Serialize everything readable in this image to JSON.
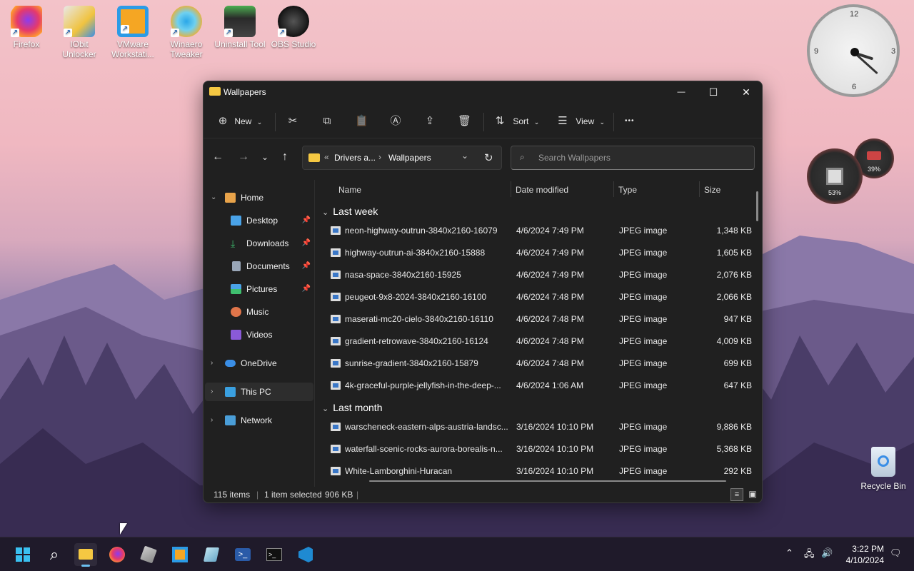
{
  "desktop": {
    "icons": [
      {
        "label": "Firefox"
      },
      {
        "label": "IObit Unlocker"
      },
      {
        "label": "VMware Workstati..."
      },
      {
        "label": "Winaero Tweaker"
      },
      {
        "label": "Uninstall Tool"
      },
      {
        "label": "OBS Studio"
      }
    ],
    "recycle_bin": "Recycle Bin",
    "clock_numbers": {
      "n12": "12",
      "n3": "3",
      "n6": "6",
      "n9": "9"
    },
    "gauges": {
      "cpu": "53%",
      "ram": "39%"
    }
  },
  "window": {
    "title": "Wallpapers",
    "controls": {
      "minimize": "—",
      "maximize": "☐",
      "close": "✕"
    },
    "toolbar": {
      "new_label": "New",
      "sort_label": "Sort",
      "view_label": "View",
      "more_label": "•••"
    },
    "address": {
      "overflow": "«",
      "crumb1": "Drivers a...",
      "crumb_sep": "›",
      "crumb2": "Wallpapers"
    },
    "search": {
      "placeholder": "Search Wallpapers"
    },
    "sidebar": {
      "items": [
        {
          "label": "Home"
        },
        {
          "label": "Desktop"
        },
        {
          "label": "Downloads"
        },
        {
          "label": "Documents"
        },
        {
          "label": "Pictures"
        },
        {
          "label": "Music"
        },
        {
          "label": "Videos"
        },
        {
          "label": "OneDrive"
        },
        {
          "label": "This PC"
        },
        {
          "label": "Network"
        }
      ]
    },
    "columns": {
      "name": "Name",
      "date": "Date modified",
      "type": "Type",
      "size": "Size"
    },
    "groups": [
      {
        "label": "Last week",
        "files": [
          {
            "name": "neon-highway-outrun-3840x2160-16079",
            "date": "4/6/2024 7:49 PM",
            "type": "JPEG image",
            "size": "1,348 KB"
          },
          {
            "name": "highway-outrun-ai-3840x2160-15888",
            "date": "4/6/2024 7:49 PM",
            "type": "JPEG image",
            "size": "1,605 KB"
          },
          {
            "name": "nasa-space-3840x2160-15925",
            "date": "4/6/2024 7:49 PM",
            "type": "JPEG image",
            "size": "2,076 KB"
          },
          {
            "name": "peugeot-9x8-2024-3840x2160-16100",
            "date": "4/6/2024 7:48 PM",
            "type": "JPEG image",
            "size": "2,066 KB"
          },
          {
            "name": "maserati-mc20-cielo-3840x2160-16110",
            "date": "4/6/2024 7:48 PM",
            "type": "JPEG image",
            "size": "947 KB"
          },
          {
            "name": "gradient-retrowave-3840x2160-16124",
            "date": "4/6/2024 7:48 PM",
            "type": "JPEG image",
            "size": "4,009 KB"
          },
          {
            "name": "sunrise-gradient-3840x2160-15879",
            "date": "4/6/2024 7:48 PM",
            "type": "JPEG image",
            "size": "699 KB"
          },
          {
            "name": "4k-graceful-purple-jellyfish-in-the-deep-...",
            "date": "4/6/2024 1:06 AM",
            "type": "JPEG image",
            "size": "647 KB"
          }
        ]
      },
      {
        "label": "Last month",
        "files": [
          {
            "name": "warscheneck-eastern-alps-austria-landsc...",
            "date": "3/16/2024 10:10 PM",
            "type": "JPEG image",
            "size": "9,886 KB"
          },
          {
            "name": "waterfall-scenic-rocks-aurora-borealis-n...",
            "date": "3/16/2024 10:10 PM",
            "type": "JPEG image",
            "size": "5,368 KB"
          },
          {
            "name": "White-Lamborghini-Huracan",
            "date": "3/16/2024 10:10 PM",
            "type": "JPEG image",
            "size": "292 KB"
          }
        ]
      }
    ],
    "status": {
      "count": "115 items",
      "selected": "1 item selected",
      "size": "906 KB"
    }
  },
  "taskbar": {
    "time": "3:22 PM",
    "date": "4/10/2024"
  }
}
